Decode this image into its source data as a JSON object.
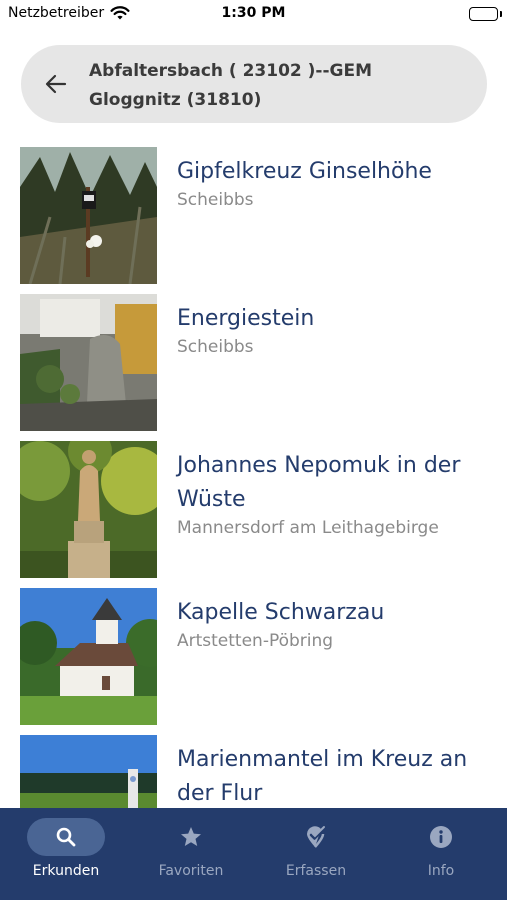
{
  "status_bar": {
    "carrier": "Netzbetreiber",
    "time": "1:30 PM"
  },
  "search": {
    "query": "Abfaltersbach ( 23102 )--GEM Gloggnitz (31810)"
  },
  "results": [
    {
      "title": "Gipfelkreuz Ginselhöhe",
      "location": "Scheibbs",
      "image": "forest-cross-photo"
    },
    {
      "title": "Energiestein",
      "location": "Scheibbs",
      "image": "stone-garden-photo"
    },
    {
      "title": "Johannes Nepomuk in der Wüste",
      "location": "Mannersdorf am Leithagebirge",
      "image": "statue-photo"
    },
    {
      "title": "Kapelle Schwarzau",
      "location": "Artstetten-Pöbring",
      "image": "chapel-photo"
    },
    {
      "title": "Marienmantel im Kreuz an der Flur",
      "location": "",
      "image": "field-shrine-photo"
    }
  ],
  "tabs": [
    {
      "label": "Erkunden",
      "icon": "search-icon",
      "active": true
    },
    {
      "label": "Favoriten",
      "icon": "star-icon",
      "active": false
    },
    {
      "label": "Erfassen",
      "icon": "location-pin-check-icon",
      "active": false
    },
    {
      "label": "Info",
      "icon": "info-icon",
      "active": false
    }
  ],
  "colors": {
    "accent": "#243c6c",
    "tab_active_pill": "#4a6594",
    "search_bg": "#e6e6e6",
    "subtitle": "#8a8a8a"
  }
}
